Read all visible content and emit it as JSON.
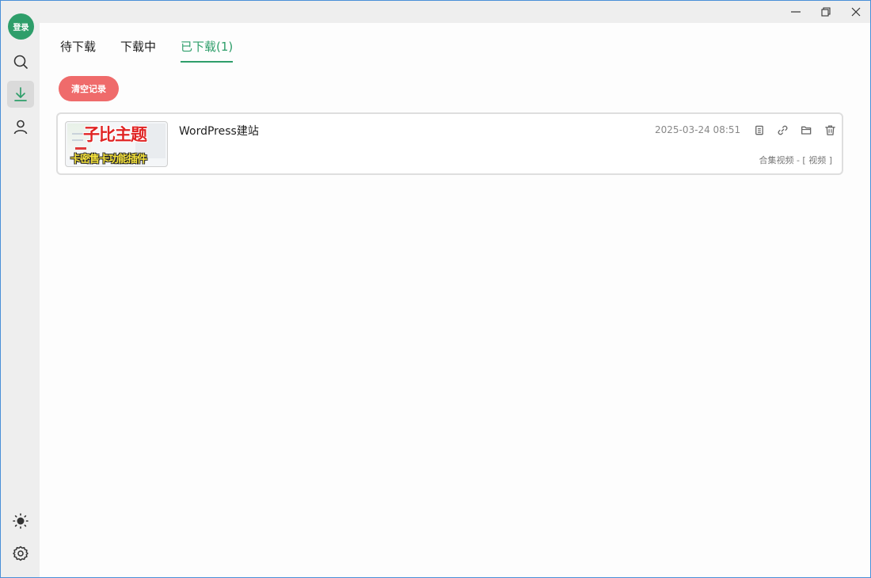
{
  "sidebar": {
    "login_label": "登录",
    "icons": [
      "search-icon",
      "download-icon",
      "user-icon",
      "theme-sun-icon",
      "gear-icon"
    ]
  },
  "tabs": [
    {
      "label": "待下载"
    },
    {
      "label": "下载中"
    },
    {
      "label": "已下载(1)"
    }
  ],
  "clear_button": {
    "label": "清空记录"
  },
  "downloads": [
    {
      "title": "WordPress建站",
      "date": "2025-03-24 08:51",
      "meta": "合集视频 - [ 视频 ]",
      "thumbnail": {
        "headline": "子比主题",
        "caption": "卡密售卡功能插件"
      }
    }
  ],
  "colors": {
    "accent": "#2e9e6a",
    "danger": "#ef6b6b"
  }
}
